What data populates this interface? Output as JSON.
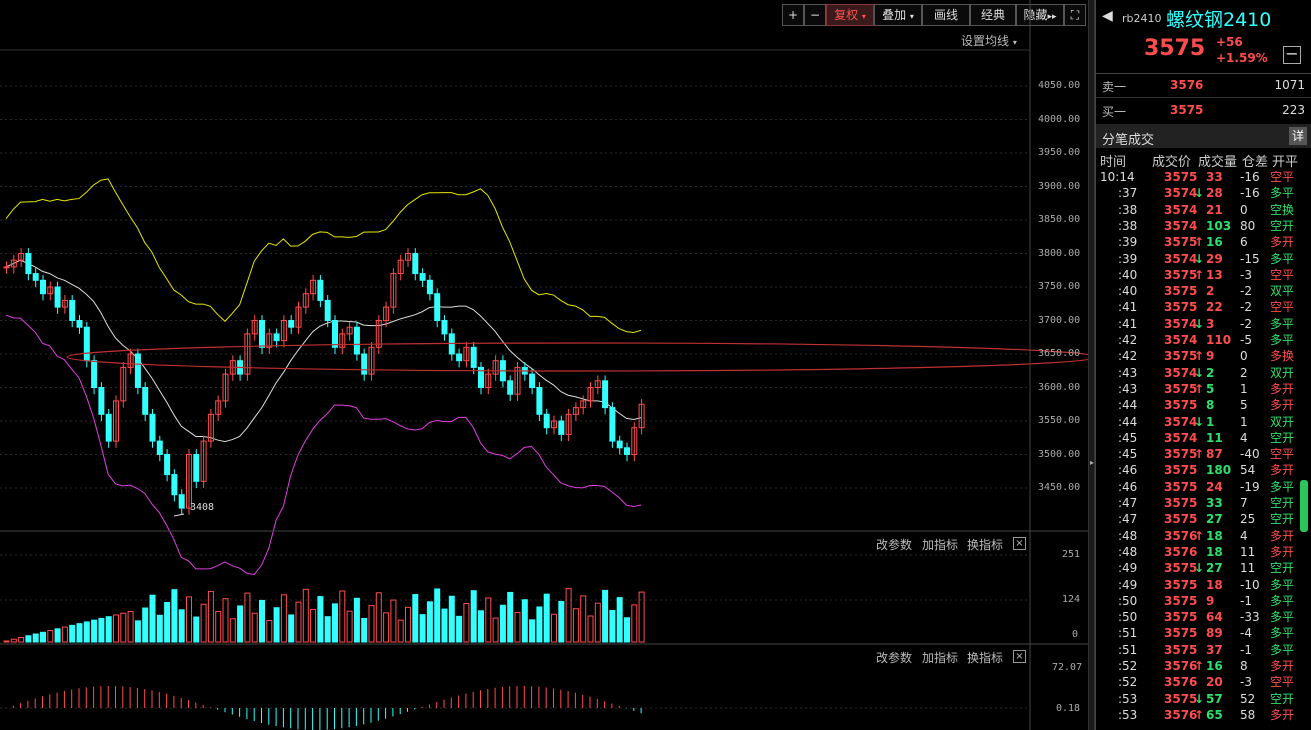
{
  "toolbar": {
    "plus": "+",
    "minus": "−",
    "fuquan": "复权",
    "diejia": "叠加",
    "huaxian": "画线",
    "jingdian": "经典",
    "yincang": "隐藏",
    "set_ma": "设置均线"
  },
  "price_axis": [
    "4050.00",
    "4000.00",
    "3950.00",
    "3900.00",
    "3850.00",
    "3800.00",
    "3750.00",
    "3700.00",
    "3650.00",
    "3600.00",
    "3550.00",
    "3500.00",
    "3450.00"
  ],
  "low_marker": "3408",
  "volume_panel": {
    "change_params": "改参数",
    "add_indicator": "加指标",
    "switch_indicator": "换指标",
    "axis": [
      "251",
      "124",
      "0"
    ]
  },
  "macd_panel": {
    "change_params": "改参数",
    "add_indicator": "加指标",
    "switch_indicator": "换指标",
    "axis": [
      "72.07",
      "0.18"
    ]
  },
  "quote": {
    "code": "rb2410",
    "name": "螺纹钢2410",
    "price": "3575",
    "change": "+56",
    "change_pct": "+1.59%",
    "ask_label": "卖一",
    "ask_price": "3576",
    "ask_vol": "1071",
    "bid_label": "买一",
    "bid_price": "3575",
    "bid_vol": "223",
    "ticks_title": "分笔成交",
    "detail": "详",
    "headers": [
      "时间",
      "成交价",
      "成交量",
      "仓差",
      "开平"
    ]
  },
  "ticks": [
    [
      "10:14",
      "3575",
      "",
      "33",
      "-16",
      "空平"
    ],
    [
      ":37",
      "3574",
      "down",
      "28",
      "-16",
      "多平"
    ],
    [
      ":38",
      "3574",
      "",
      "21",
      "0",
      "空换"
    ],
    [
      ":38",
      "3574",
      "",
      "103",
      "80",
      "空开"
    ],
    [
      ":39",
      "3575",
      "up",
      "16",
      "6",
      "多开"
    ],
    [
      ":39",
      "3574",
      "down",
      "29",
      "-15",
      "多平"
    ],
    [
      ":40",
      "3575",
      "up",
      "13",
      "-3",
      "空平"
    ],
    [
      ":40",
      "3575",
      "",
      "2",
      "-2",
      "双平"
    ],
    [
      ":41",
      "3575",
      "",
      "22",
      "-2",
      "空平"
    ],
    [
      ":41",
      "3574",
      "down",
      "3",
      "-2",
      "多平"
    ],
    [
      ":42",
      "3574",
      "",
      "110",
      "-5",
      "多平"
    ],
    [
      ":42",
      "3575",
      "up",
      "9",
      "0",
      "多换"
    ],
    [
      ":43",
      "3574",
      "down",
      "2",
      "2",
      "双开"
    ],
    [
      ":43",
      "3575",
      "up",
      "5",
      "1",
      "多开"
    ],
    [
      ":44",
      "3575",
      "",
      "8",
      "5",
      "多开"
    ],
    [
      ":44",
      "3574",
      "down",
      "1",
      "1",
      "双开"
    ],
    [
      ":45",
      "3574",
      "",
      "11",
      "4",
      "空开"
    ],
    [
      ":45",
      "3575",
      "up",
      "87",
      "-40",
      "空平"
    ],
    [
      ":46",
      "3575",
      "",
      "180",
      "54",
      "多开"
    ],
    [
      ":46",
      "3575",
      "",
      "24",
      "-19",
      "多平"
    ],
    [
      ":47",
      "3575",
      "",
      "33",
      "7",
      "空开"
    ],
    [
      ":47",
      "3575",
      "",
      "27",
      "25",
      "空开"
    ],
    [
      ":48",
      "3576",
      "up",
      "18",
      "4",
      "多开"
    ],
    [
      ":48",
      "3576",
      "",
      "18",
      "11",
      "多开"
    ],
    [
      ":49",
      "3575",
      "down",
      "27",
      "11",
      "空开"
    ],
    [
      ":49",
      "3575",
      "",
      "18",
      "-10",
      "多平"
    ],
    [
      ":50",
      "3575",
      "",
      "9",
      "-1",
      "多平"
    ],
    [
      ":50",
      "3575",
      "",
      "64",
      "-33",
      "多平"
    ],
    [
      ":51",
      "3575",
      "",
      "89",
      "-4",
      "多平"
    ],
    [
      ":51",
      "3575",
      "",
      "37",
      "-1",
      "多平"
    ],
    [
      ":52",
      "3576",
      "up",
      "16",
      "8",
      "多开"
    ],
    [
      ":52",
      "3576",
      "",
      "20",
      "-3",
      "空平"
    ],
    [
      ":53",
      "3575",
      "down",
      "57",
      "52",
      "空开"
    ],
    [
      ":53",
      "3576",
      "up",
      "65",
      "58",
      "多开"
    ]
  ],
  "colors": {
    "up": "#ff4d4d",
    "down": "#2ee06a",
    "cyan": "#33ffff",
    "yellow": "#e6e600",
    "magenta": "#e040e0",
    "white": "#dddddd"
  }
}
